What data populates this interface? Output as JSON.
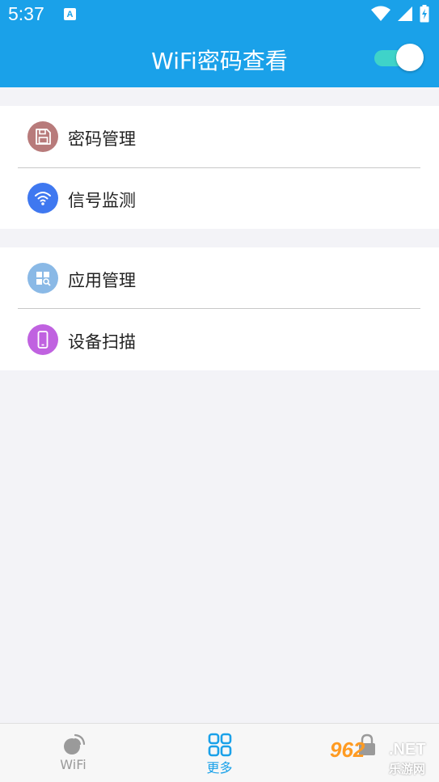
{
  "statusbar": {
    "time": "5:37",
    "notif_letter": "A"
  },
  "appbar": {
    "title": "WiFi密码查看",
    "toggle_on": true
  },
  "groups": [
    {
      "items": [
        {
          "label": "密码管理",
          "icon": "save-icon",
          "color": "#b87b7b"
        },
        {
          "label": "信号监测",
          "icon": "wifi-icon",
          "color": "#3f78f0"
        }
      ]
    },
    {
      "items": [
        {
          "label": "应用管理",
          "icon": "apps-search-icon",
          "color": "#8ab9e6"
        },
        {
          "label": "设备扫描",
          "icon": "phone-icon",
          "color": "#c062e0"
        }
      ]
    }
  ],
  "bottom_nav": {
    "items": [
      {
        "label": "WiFi",
        "icon": "satellite-dish-icon",
        "active": false
      },
      {
        "label": "更多",
        "icon": "grid-icon",
        "active": true
      },
      {
        "label": "",
        "icon": "lock-icon",
        "active": false
      }
    ],
    "active_color": "#1aa1e9",
    "inactive_color": "#9a9a9a"
  },
  "watermark": {
    "number": "962",
    "net": ".NET",
    "site": "乐游网"
  }
}
